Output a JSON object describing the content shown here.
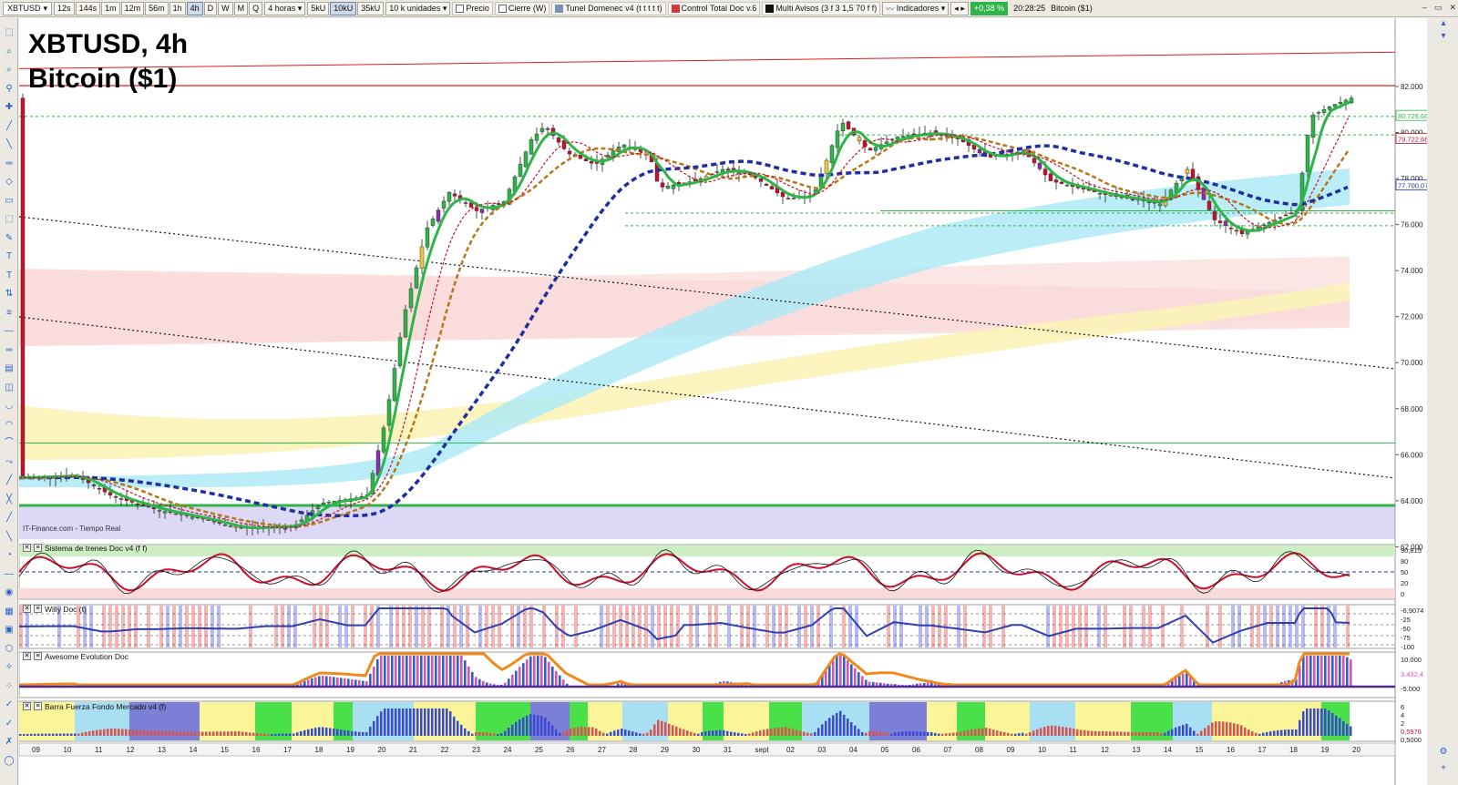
{
  "toolbar": {
    "symbol": "XBTUSD",
    "timeframes": [
      "12s",
      "144s",
      "1m",
      "12m",
      "56m",
      "1h",
      "4h",
      "D",
      "W",
      "M",
      "Q"
    ],
    "active_timeframe": "4h",
    "period": "4 horas",
    "units": [
      "5kU",
      "10kU",
      "35kU"
    ],
    "active_unit": "10kU",
    "unit_count": "10 k unidades",
    "checks": [
      "Precio",
      "Cierre (W)",
      "Tunel Domenec v4 (t t t t t)",
      "Control Total Doc v.6",
      "Multi Avisos (3 f 3 1,5 70 f f)"
    ],
    "indicators_label": "Indicadores",
    "change": "+0,38 %",
    "time": "20:28:25",
    "instrument": "Bitcoin ($1)"
  },
  "chart": {
    "title_line1": "XBTUSD, 4h",
    "title_line2": "Bitcoin ($1)",
    "source": "IT-Finance.com - Tiempo Real",
    "price_ticks": [
      "82.000",
      "80.000",
      "78.000",
      "76.000",
      "74.000",
      "72.000",
      "70.000",
      "68.000",
      "66.000",
      "64.000",
      "62.000"
    ],
    "price_tags": [
      {
        "label": "80.726,66",
        "color": "#2fb44a"
      },
      {
        "label": "79.722,68",
        "color": "#c8102e"
      },
      {
        "label": "77.700,07",
        "color": "#1f2f9e"
      }
    ],
    "date_labels": [
      "09",
      "10",
      "11",
      "12",
      "13",
      "14",
      "15",
      "16",
      "17",
      "18",
      "19",
      "20",
      "21",
      "22",
      "23",
      "24",
      "25",
      "26",
      "27",
      "28",
      "29",
      "30",
      "31",
      "sept",
      "02",
      "03",
      "04",
      "05",
      "06",
      "07",
      "08",
      "09",
      "10",
      "11",
      "12",
      "13",
      "14",
      "15",
      "16",
      "17",
      "18",
      "19",
      "20"
    ],
    "colors": {
      "bull": "#2fb44a",
      "bear": "#c8102e",
      "support": "#2fb44a",
      "resistance": "#e41a1c",
      "trend_blue": "#1f2f9e",
      "trend_brown": "#b8761a"
    }
  },
  "panes": [
    {
      "name": "Sistema de trenes Doc v4 (f f)",
      "ticks": [
        "90,815",
        "80",
        "50",
        "20",
        "0"
      ]
    },
    {
      "name": "Willy Doc (t)",
      "ticks": [
        "-6,9074",
        "-25",
        "-50",
        "-75",
        "-100"
      ]
    },
    {
      "name": "Awesome Evolution Doc",
      "ticks": [
        "10.000",
        "3.432,4",
        "-5.000"
      ]
    },
    {
      "name": "Barra Fuerza Fondo Mercado v4 (f)",
      "ticks": [
        "6",
        "4",
        "2",
        "0,5976",
        "0,5000"
      ]
    }
  ]
}
